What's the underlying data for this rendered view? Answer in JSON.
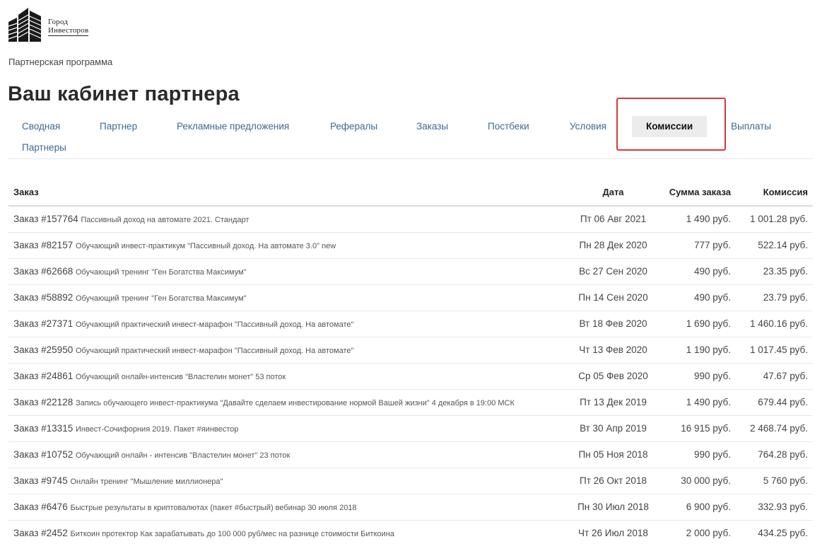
{
  "logo": {
    "line1": "Город",
    "line2": "Инвесторов"
  },
  "breadcrumb": "Партнерская программа",
  "page_title": "Ваш кабинет партнера",
  "tabs": [
    {
      "label": "Сводная",
      "active": false
    },
    {
      "label": "Партнер",
      "active": false
    },
    {
      "label": "Рекламные предложения",
      "active": false
    },
    {
      "label": "Рефералы",
      "active": false
    },
    {
      "label": "Заказы",
      "active": false
    },
    {
      "label": "Постбеки",
      "active": false
    },
    {
      "label": "Условия",
      "active": false
    },
    {
      "label": "Комиссии",
      "active": true
    },
    {
      "label": "Выплаты",
      "active": false
    },
    {
      "label": "Партнеры",
      "active": false
    }
  ],
  "table": {
    "headers": {
      "order": "Заказ",
      "date": "Дата",
      "sum": "Сумма заказа",
      "commission": "Комиссия"
    },
    "rows": [
      {
        "num": "Заказ #157764",
        "desc": "Пассивный доход на автомате 2021. Стандарт",
        "date": "Пт 06 Авг 2021",
        "sum": "1 490 руб.",
        "commission": "1 001.28 руб."
      },
      {
        "num": "Заказ #82157",
        "desc": "Обучающий инвест-практикум \"Пассивный доход. На автомате 3.0\" new",
        "date": "Пн 28 Дек 2020",
        "sum": "777 руб.",
        "commission": "522.14 руб."
      },
      {
        "num": "Заказ #62668",
        "desc": "Обучающий тренинг \"Ген Богатства Максимум\"",
        "date": "Вс 27 Сен 2020",
        "sum": "490 руб.",
        "commission": "23.35 руб."
      },
      {
        "num": "Заказ #58892",
        "desc": "Обучающий тренинг \"Ген Богатства Максимум\"",
        "date": "Пн 14 Сен 2020",
        "sum": "490 руб.",
        "commission": "23.79 руб."
      },
      {
        "num": "Заказ #27371",
        "desc": "Обучающий практический инвест-марафон \"Пассивный доход. На автомате\"",
        "date": "Вт 18 Фев 2020",
        "sum": "1 690 руб.",
        "commission": "1 460.16 руб."
      },
      {
        "num": "Заказ #25950",
        "desc": "Обучающий практический инвест-марафон \"Пассивный доход. На автомате\"",
        "date": "Чт 13 Фев 2020",
        "sum": "1 190 руб.",
        "commission": "1 017.45 руб."
      },
      {
        "num": "Заказ #24861",
        "desc": "Обучающий онлайн-интенсив \"Властелин монет\" 53 поток",
        "date": "Ср 05 Фев 2020",
        "sum": "990 руб.",
        "commission": "47.67 руб."
      },
      {
        "num": "Заказ #22128",
        "desc": "Запись обучающего инвест-практикума \"Давайте сделаем инвестирование нормой Вашей жизни\" 4 декабря в 19:00 МСК",
        "date": "Пт 13 Дек 2019",
        "sum": "1 490 руб.",
        "commission": "679.44 руб."
      },
      {
        "num": "Заказ #13315",
        "desc": "Инвест-Сочифорния 2019. Пакет #яинвестор",
        "date": "Вт 30 Апр 2019",
        "sum": "16 915 руб.",
        "commission": "2 468.74 руб."
      },
      {
        "num": "Заказ #10752",
        "desc": "Обучающий онлайн - интенсив \"Властелин монет\" 23 поток",
        "date": "Пн 05 Ноя 2018",
        "sum": "990 руб.",
        "commission": "764.28 руб."
      },
      {
        "num": "Заказ #9745",
        "desc": "Онлайн тренинг \"Мышление миллионера\"",
        "date": "Пт 26 Окт 2018",
        "sum": "30 000 руб.",
        "commission": "5 760 руб."
      },
      {
        "num": "Заказ #6476",
        "desc": "Быстрые результаты в криптовалютах (пакет #быстрый) вебинар 30 июля 2018",
        "date": "Пн 30 Июл 2018",
        "sum": "6 900 руб.",
        "commission": "332.93 руб."
      },
      {
        "num": "Заказ #2452",
        "desc": "Биткоин протектор Как зарабатывать до 100 000 руб/мес на разнице стоимости Биткоина",
        "date": "Чт 26 Июл 2018",
        "sum": "2 000 руб.",
        "commission": "434.25 руб."
      }
    ]
  }
}
